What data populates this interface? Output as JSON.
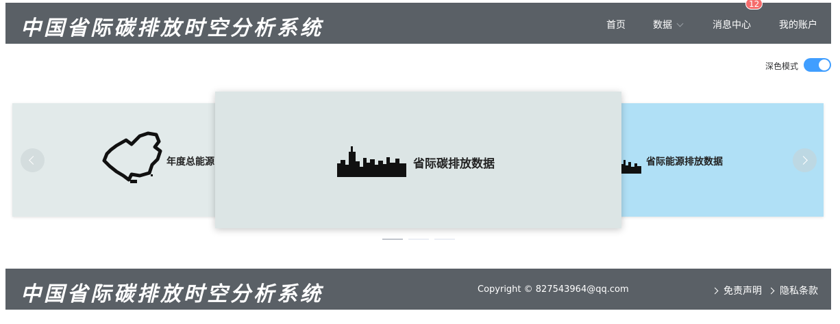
{
  "header": {
    "logo_text": "中国省际碳排放时空分析系统",
    "nav": {
      "home": "首页",
      "data": "数据",
      "messages": "消息中心",
      "messages_badge": "12",
      "account": "我的账户"
    }
  },
  "settings": {
    "dark_mode_label": "深色模式",
    "dark_mode_on": true
  },
  "carousel": {
    "cards": [
      {
        "title": "年度总能源",
        "icon": "china-map-icon"
      },
      {
        "title": "省际碳排放数据",
        "icon": "city-skyline-icon"
      },
      {
        "title": "省际能源排放数据",
        "icon": "city-skyline-icon"
      }
    ],
    "indicator_count": 3,
    "active_indicator": 0
  },
  "footer": {
    "logo_text": "中国省际碳排放时空分析系统",
    "copyright": "Copyright © 827543964@qq.com",
    "links": {
      "disclaimer": "免责声明",
      "privacy": "隐私条款"
    }
  },
  "colors": {
    "header_bg": "#5a6066",
    "switch_on": "#409eff",
    "badge": "#f56c6c",
    "card_center_bg": "#dce5e5",
    "card_right_bg": "#b0e0f6"
  }
}
